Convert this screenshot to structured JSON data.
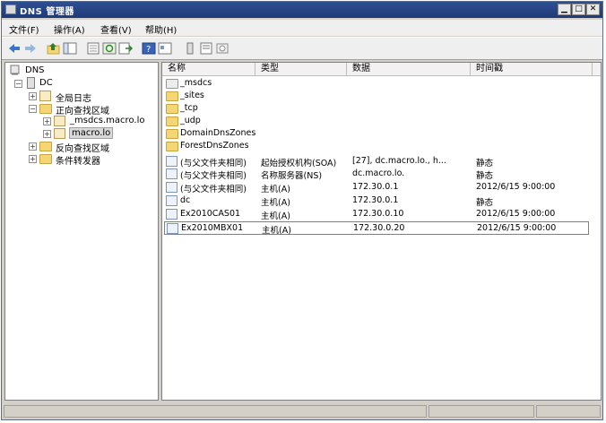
{
  "window": {
    "title": "DNS 管理器"
  },
  "menu": [
    {
      "label": "文件(F)"
    },
    {
      "label": "操作(A)"
    },
    {
      "label": "查看(V)"
    },
    {
      "label": "帮助(H)"
    }
  ],
  "toolbar": [
    {
      "name": "back-icon"
    },
    {
      "name": "forward-icon"
    },
    {
      "name": "up-icon"
    },
    {
      "name": "show-tree-icon"
    },
    {
      "name": "properties-icon"
    },
    {
      "name": "refresh-icon"
    },
    {
      "name": "export-icon"
    },
    {
      "name": "help-icon"
    },
    {
      "name": "view-icon"
    },
    {
      "name": "server-icon"
    },
    {
      "name": "list-icon"
    },
    {
      "name": "filter-icon"
    }
  ],
  "tree": {
    "root": "DNS",
    "server": "DC",
    "items": [
      {
        "label": "全局日志"
      },
      {
        "label": "正向查找区域"
      },
      {
        "label": "_msdcs.macro.lo"
      },
      {
        "label": "macro.lo"
      },
      {
        "label": "反向查找区域"
      },
      {
        "label": "条件转发器"
      }
    ]
  },
  "list": {
    "columns": [
      "名称",
      "类型",
      "数据",
      "时间戳"
    ],
    "folders": [
      "_msdcs",
      "_sites",
      "_tcp",
      "_udp",
      "DomainDnsZones",
      "ForestDnsZones"
    ],
    "rows": [
      {
        "name": "(与父文件夹相同)",
        "type": "起始授权机构(SOA)",
        "data": "[27], dc.macro.lo., h...",
        "timestamp": "静态"
      },
      {
        "name": "(与父文件夹相同)",
        "type": "名称服务器(NS)",
        "data": "dc.macro.lo.",
        "timestamp": "静态"
      },
      {
        "name": "(与父文件夹相同)",
        "type": "主机(A)",
        "data": "172.30.0.1",
        "timestamp": "2012/6/15 9:00:00"
      },
      {
        "name": "dc",
        "type": "主机(A)",
        "data": "172.30.0.1",
        "timestamp": "静态"
      },
      {
        "name": "Ex2010CAS01",
        "type": "主机(A)",
        "data": "172.30.0.10",
        "timestamp": "2012/6/15 9:00:00"
      },
      {
        "name": "Ex2010MBX01",
        "type": "主机(A)",
        "data": "172.30.0.20",
        "timestamp": "2012/6/15 9:00:00"
      }
    ]
  }
}
